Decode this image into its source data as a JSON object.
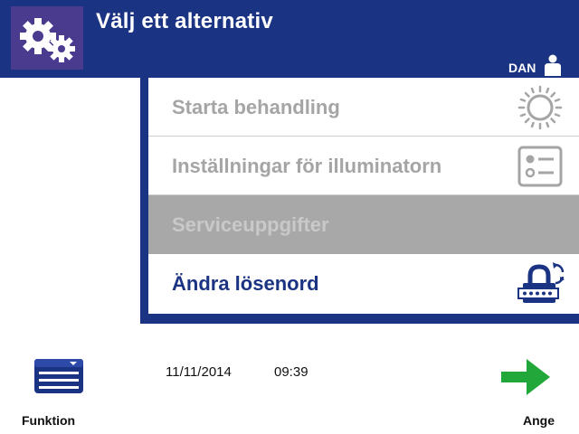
{
  "header": {
    "title": "Välj ett alternativ",
    "icon": "gears-icon",
    "user": {
      "name": "DAN",
      "icon": "user-icon"
    }
  },
  "menu": {
    "items": [
      {
        "label": "Starta behandling",
        "icon": "sun-icon",
        "state": "disabled"
      },
      {
        "label": "Inställningar för illuminatorn",
        "icon": "settings-list-icon",
        "state": "disabled"
      },
      {
        "label": "Serviceuppgifter",
        "icon": "",
        "state": "disabled-highlighted"
      },
      {
        "label": "Ändra lösenord",
        "icon": "password-lock-icon",
        "state": "enabled"
      }
    ]
  },
  "footer": {
    "function_label": "Funktion",
    "function_icon": "function-menu-icon",
    "date": "11/11/2014",
    "time": "09:39",
    "enter_label": "Ange",
    "enter_icon": "green-arrow-right-icon"
  },
  "colors": {
    "header_bg": "#1b3383",
    "gear_tile_bg": "#4a3b8f",
    "disabled_text": "#a5a5a5",
    "highlight_bg": "#a8a8a8",
    "accent_green": "#22a83a"
  }
}
